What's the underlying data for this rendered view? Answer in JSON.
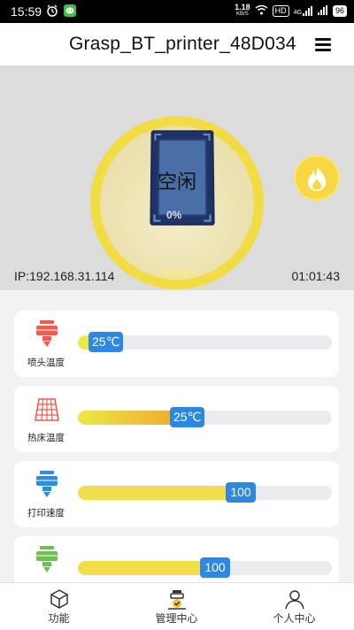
{
  "status_bar": {
    "time": "15:59",
    "net_speed_value": "1.18",
    "net_speed_unit": "KB/S",
    "hd_badge": "HD",
    "lte_badge": "4G",
    "battery": "96"
  },
  "app_bar": {
    "title": "Grasp_BT_printer_48D034",
    "menu_icon": "hamburger-menu-icon"
  },
  "hero": {
    "status": "空闲",
    "progress_text": "0%",
    "progress": 0,
    "ip_text": "IP:192.168.31.114",
    "elapsed": "01:01:43",
    "accent_color": "#f2dc43",
    "preheat_icon": "fire-icon"
  },
  "cards": [
    {
      "label": "喷头温度",
      "value_text": "25℃",
      "fraction": 0.1,
      "icon": "nozzle-icon",
      "icon_color": "#f15a4f",
      "fill": "linear-gradient(90deg,#e8ec50,#f1e63a)"
    },
    {
      "label": "热床温度",
      "value_text": "25℃",
      "fraction": 0.42,
      "icon": "heated-bed-icon",
      "icon_color": "#f15a4f",
      "fill": "linear-gradient(90deg,#ece744,#f0a62b)"
    },
    {
      "label": "打印速度",
      "value_text": "100",
      "fraction": 0.64,
      "icon": "print-speed-icon",
      "icon_color": "#2d8be0",
      "fill": "#f2de4a"
    },
    {
      "label": "",
      "value_text": "100",
      "fraction": 0.54,
      "icon": "fan-speed-icon",
      "icon_color": "#6cc24a",
      "fill": "#f2de4a"
    }
  ],
  "bottom_nav": [
    {
      "label": "功能",
      "icon": "cube-icon"
    },
    {
      "label": "管理中心",
      "icon": "printer-manage-icon"
    },
    {
      "label": "个人中心",
      "icon": "user-icon"
    }
  ]
}
